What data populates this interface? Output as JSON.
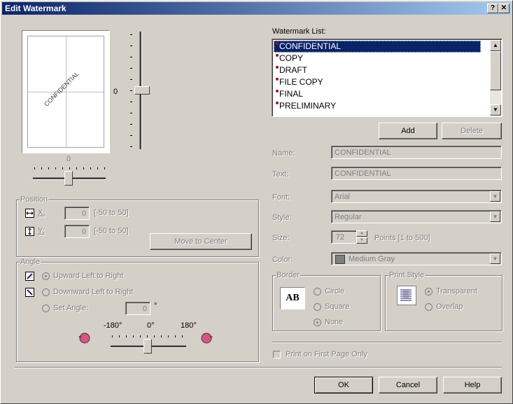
{
  "window": {
    "title": "Edit Watermark",
    "help_btn": "?",
    "close_btn": "✕"
  },
  "preview": {
    "watermark_text": "CONFIDENTIAL",
    "vertical_slider_value": "0",
    "horizontal_slider_value": "0"
  },
  "position": {
    "group_label": "Position",
    "x_label": "X:",
    "x_value": "0",
    "x_range": "[-50 to 50]",
    "y_label": "Y:",
    "y_value": "0",
    "y_range": "[-50 to 50]",
    "move_to_center": "Move to Center"
  },
  "angle": {
    "group_label": "Angle",
    "upward": "Upward Left to Right",
    "downward": "Downward Left to Right",
    "set_angle": "Set Angle:",
    "set_angle_value": "0",
    "degree_symbol": "°",
    "min": "-180°",
    "mid": "0°",
    "max": "180°"
  },
  "watermark_list": {
    "label": "Watermark List:",
    "items": [
      "CONFIDENTIAL",
      "COPY",
      "DRAFT",
      "FILE COPY",
      "FINAL",
      "PRELIMINARY"
    ],
    "selected": "CONFIDENTIAL"
  },
  "buttons": {
    "add": "Add",
    "delete": "Delete",
    "ok": "OK",
    "cancel": "Cancel",
    "help": "Help"
  },
  "fields": {
    "name_label": "Name:",
    "name_value": "CONFIDENTIAL",
    "text_label": "Text:",
    "text_value": "CONFIDENTIAL",
    "font_label": "Font:",
    "font_value": "Arial",
    "style_label": "Style:",
    "style_value": "Regular",
    "size_label": "Size:",
    "size_value": "72",
    "size_units": "Points [1 to 500]",
    "color_label": "Color:",
    "color_value": "Medium Gray",
    "color_swatch": "#808080"
  },
  "border": {
    "group_label": "Border",
    "sample": "AB",
    "circle": "Circle",
    "square": "Square",
    "none": "None"
  },
  "print_style": {
    "group_label": "Print Style",
    "transparent": "Transparent",
    "overlap": "Overlap"
  },
  "first_page_only": "Print on First Page Only",
  "colors": {
    "title_start": "#0a246a",
    "title_end": "#a6caf0",
    "selection": "#0a246a",
    "dialog_bg": "#d4d0c8",
    "bullet": "#c00000",
    "rotate_icon": "#e05080"
  }
}
